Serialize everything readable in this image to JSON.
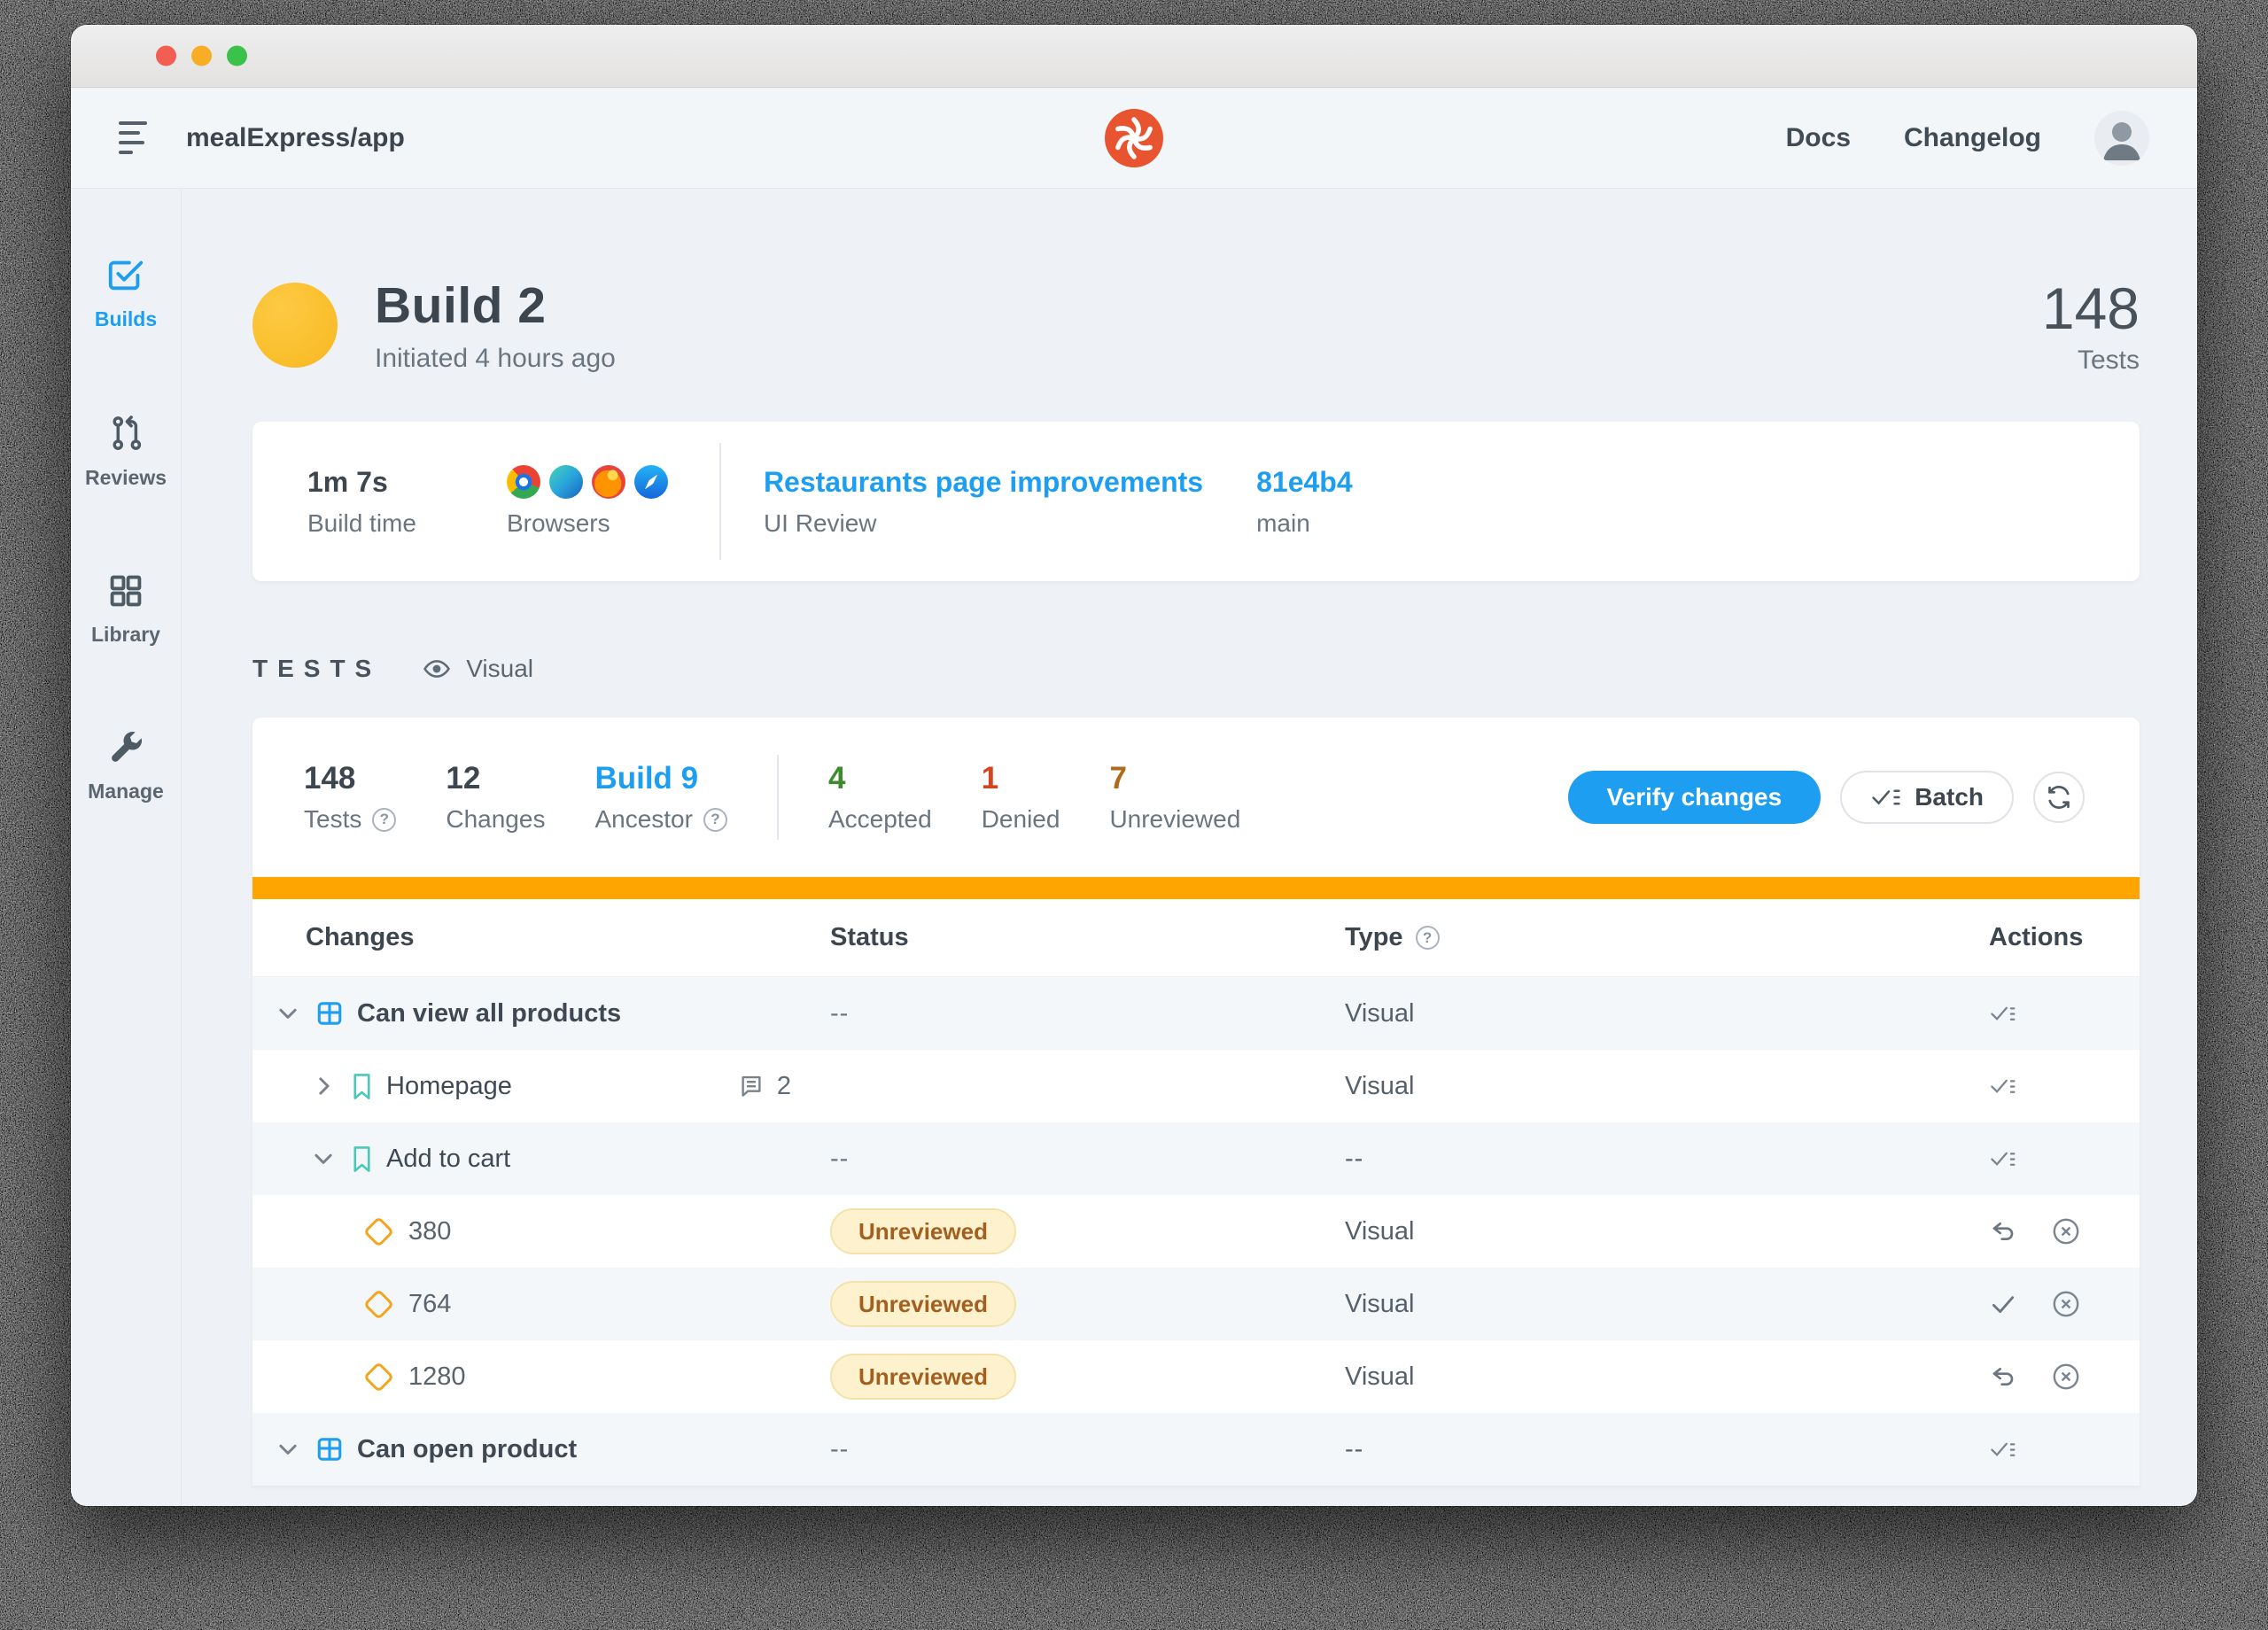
{
  "colors": {
    "accent_blue": "#1e9ef0",
    "progress_orange": "#ffa502",
    "build_avatar_yellow": "#f8b81f",
    "logo_red": "#e8542f",
    "accepted_green": "#3e8b2f",
    "denied_red": "#d2451e",
    "unreviewed_orange": "#b06a1e",
    "bookmark_teal": "#49c9b8",
    "diamond_orange": "#f2a51f",
    "badge_bg": "#fdf2cd",
    "badge_text": "#a35f1f"
  },
  "icons": {
    "help_glyph": "?"
  },
  "nav": {
    "project": "mealExpress/app",
    "docs": "Docs",
    "changelog": "Changelog"
  },
  "sidebar": {
    "items": [
      {
        "label": "Builds",
        "active": true
      },
      {
        "label": "Reviews",
        "active": false
      },
      {
        "label": "Library",
        "active": false
      },
      {
        "label": "Manage",
        "active": false
      }
    ]
  },
  "build_header": {
    "title": "Build 2",
    "subtitle": "Initiated 4 hours ago",
    "tests_value": "148",
    "tests_label": "Tests"
  },
  "summary_card": {
    "build_time_value": "1m 7s",
    "build_time_label": "Build time",
    "browsers_label": "Browsers",
    "browsers": [
      "chrome",
      "edge",
      "firefox",
      "safari"
    ],
    "review_title": "Restaurants page improvements",
    "review_label": "UI Review",
    "commit": "81e4b4",
    "branch": "main"
  },
  "tests_section": {
    "heading": "TESTS",
    "view_filter": "Visual"
  },
  "stats": {
    "tests_value": "148",
    "tests_label": "Tests",
    "changes_value": "12",
    "changes_label": "Changes",
    "ancestor_value": "Build 9",
    "ancestor_label": "Ancestor",
    "accepted_value": "4",
    "accepted_label": "Accepted",
    "denied_value": "1",
    "denied_label": "Denied",
    "unreviewed_value": "7",
    "unreviewed_label": "Unreviewed"
  },
  "toolbar": {
    "verify_label": "Verify changes",
    "batch_label": "Batch"
  },
  "table": {
    "columns": {
      "changes": "Changes",
      "status": "Status",
      "type": "Type",
      "actions": "Actions"
    },
    "rows": [
      {
        "name": "Can view all products",
        "status": "--",
        "type": "Visual"
      },
      {
        "name": "Homepage",
        "comments": "2",
        "type": "Visual"
      },
      {
        "name": "Add to cart",
        "status": "--",
        "type": "--"
      },
      {
        "name": "380",
        "badge": "Unreviewed",
        "type": "Visual"
      },
      {
        "name": "764",
        "badge": "Unreviewed",
        "type": "Visual"
      },
      {
        "name": "1280",
        "badge": "Unreviewed",
        "type": "Visual"
      },
      {
        "name": "Can open product",
        "status": "--",
        "type": "--"
      }
    ]
  }
}
